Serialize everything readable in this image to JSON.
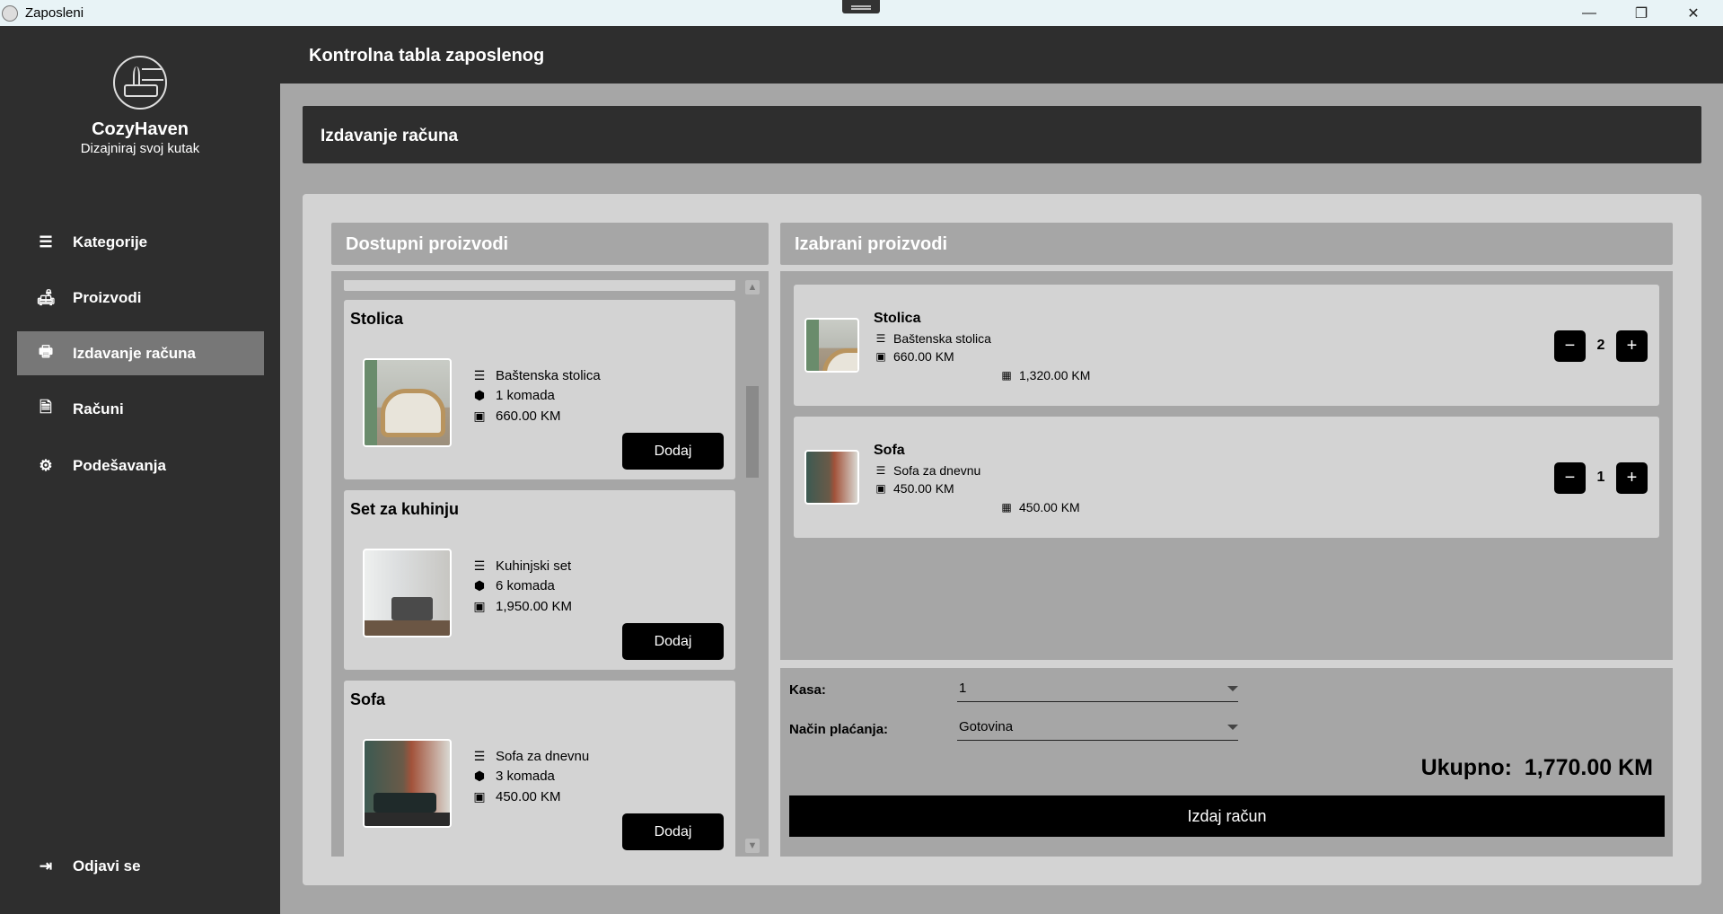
{
  "window": {
    "title": "Zaposleni",
    "controls": [
      "—",
      "❐",
      "✕"
    ]
  },
  "brand": {
    "name": "CozyHaven",
    "tagline": "Dizajniraj svoj kutak"
  },
  "sidebar": {
    "items": [
      {
        "label": "Kategorije",
        "icon": "list-icon",
        "glyph": "☰"
      },
      {
        "label": "Proizvodi",
        "icon": "sofa-icon",
        "glyph": "🛋"
      },
      {
        "label": "Izdavanje računa",
        "icon": "cash-register-icon",
        "glyph": "🖶",
        "active": true
      },
      {
        "label": "Računi",
        "icon": "document-icon",
        "glyph": "🗎"
      },
      {
        "label": "Podešavanja",
        "icon": "gear-icon",
        "glyph": "⚙"
      }
    ],
    "logout": {
      "label": "Odjavi se",
      "icon": "logout-icon",
      "glyph": "⇥"
    }
  },
  "header": {
    "title": "Kontrolna tabla zaposlenog"
  },
  "section": {
    "title": "Izdavanje računa"
  },
  "available": {
    "title": "Dostupni proizvodi",
    "add_label": "Dodaj",
    "products": [
      {
        "name": "Stolica",
        "description": "Baštenska stolica",
        "stock": "1 komada",
        "price": "660.00 KM",
        "image": "chair"
      },
      {
        "name": "Set za kuhinju",
        "description": "Kuhinjski set",
        "stock": "6 komada",
        "price": "1,950.00 KM",
        "image": "kitchen"
      },
      {
        "name": "Sofa",
        "description": "Sofa za dnevnu",
        "stock": "3 komada",
        "price": "450.00 KM",
        "image": "sofa"
      }
    ]
  },
  "selected": {
    "title": "Izabrani proizvodi",
    "items": [
      {
        "name": "Stolica",
        "description": "Baštenska stolica",
        "price": "660.00 KM",
        "quantity": "2",
        "subtotal": "1,320.00 KM",
        "image": "chair"
      },
      {
        "name": "Sofa",
        "description": "Sofa za dnevnu",
        "price": "450.00 KM",
        "quantity": "1",
        "subtotal": "450.00 KM",
        "image": "sofa"
      }
    ]
  },
  "invoice": {
    "register_label": "Kasa:",
    "register_value": "1",
    "payment_label": "Način plaćanja:",
    "payment_value": "Gotovina",
    "total_label": "Ukupno:",
    "total_value": "1,770.00 KM",
    "issue_label": "Izdaj račun"
  },
  "colors": {
    "sidebar_bg": "#2e2e2e",
    "active_item": "#777777",
    "panel_bg": "#d3d3d3",
    "section_bg": "#a6a6a6",
    "button_bg": "#000000"
  }
}
